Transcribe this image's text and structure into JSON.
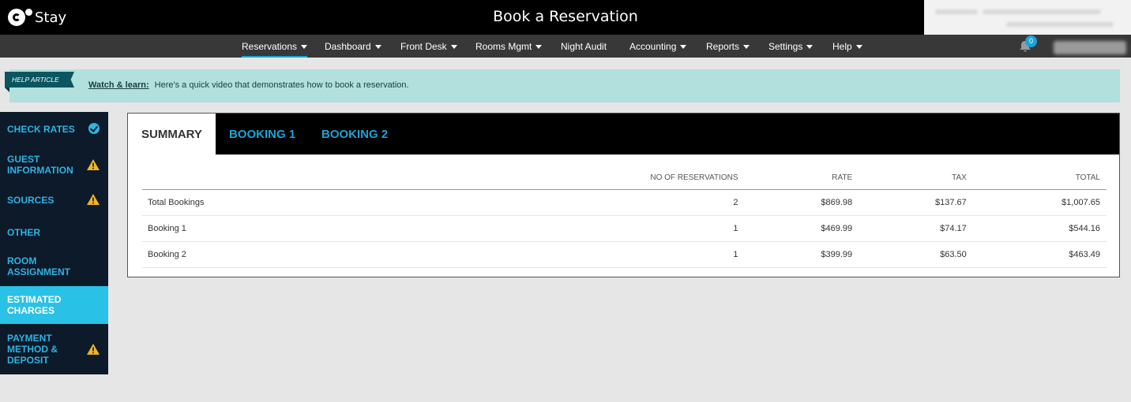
{
  "app": {
    "logo_text": "Stay",
    "page_title": "Book a Reservation"
  },
  "nav": {
    "items": [
      {
        "label": "Reservations",
        "has_caret": true,
        "active": true
      },
      {
        "label": "Dashboard",
        "has_caret": true
      },
      {
        "label": "Front Desk",
        "has_caret": true
      },
      {
        "label": "Rooms Mgmt",
        "has_caret": true
      },
      {
        "label": "Night Audit",
        "has_caret": false
      },
      {
        "label": "Accounting",
        "has_caret": true
      },
      {
        "label": "Reports",
        "has_caret": true
      },
      {
        "label": "Settings",
        "has_caret": true
      },
      {
        "label": "Help",
        "has_caret": true
      }
    ],
    "notification_count": "0"
  },
  "help": {
    "tag": "HELP ARTICLE",
    "link_label": "Watch & learn:",
    "text": "Here's a quick video that demonstrates how to book a reservation."
  },
  "sidebar": {
    "items": [
      {
        "label": "CHECK RATES",
        "status": "check"
      },
      {
        "label": "GUEST INFORMATION",
        "status": "warning"
      },
      {
        "label": "SOURCES",
        "status": "warning"
      },
      {
        "label": "OTHER",
        "status": "none"
      },
      {
        "label": "ROOM ASSIGNMENT",
        "status": "none"
      },
      {
        "label": "ESTIMATED CHARGES",
        "status": "active"
      },
      {
        "label": "PAYMENT METHOD & DEPOSIT",
        "status": "warning"
      }
    ]
  },
  "tabs": [
    {
      "label": "SUMMARY"
    },
    {
      "label": "BOOKING 1"
    },
    {
      "label": "BOOKING 2"
    }
  ],
  "summary": {
    "headers": {
      "name": "",
      "reservations": "NO OF RESERVATIONS",
      "rate": "RATE",
      "tax": "TAX",
      "total": "TOTAL"
    },
    "rows": [
      {
        "name": "Total Bookings",
        "reservations": "2",
        "rate": "$869.98",
        "tax": "$137.67",
        "total": "$1,007.65"
      },
      {
        "name": "Booking 1",
        "reservations": "1",
        "rate": "$469.99",
        "tax": "$74.17",
        "total": "$544.16"
      },
      {
        "name": "Booking 2",
        "reservations": "1",
        "rate": "$399.99",
        "tax": "$63.50",
        "total": "$463.49"
      }
    ]
  },
  "colors": {
    "accent": "#1aa3d6",
    "sidebar_bg": "#0c1a2a",
    "active_item": "#29c1e6",
    "warning": "#f0b323",
    "help_bg": "#b2e0dc"
  }
}
